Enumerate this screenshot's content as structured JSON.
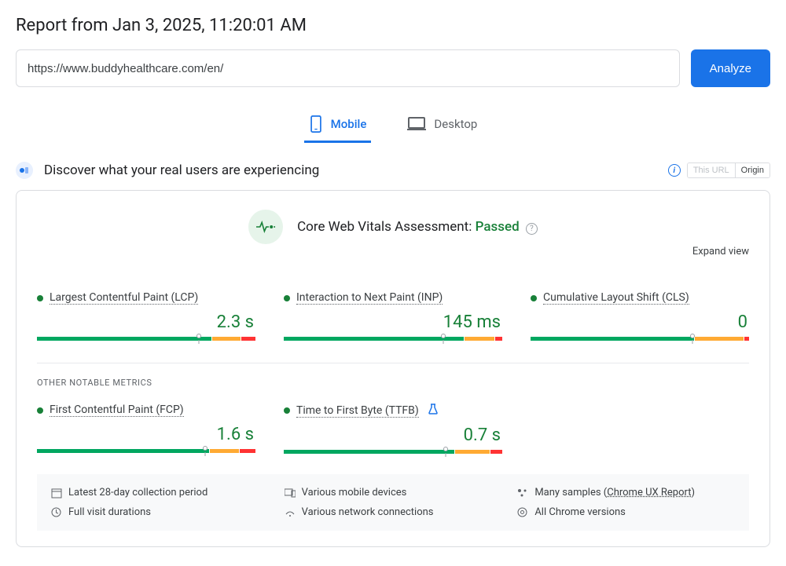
{
  "title": "Report from Jan 3, 2025, 11:20:01 AM",
  "url_value": "https://www.buddyhealthcare.com/en/",
  "analyze_label": "Analyze",
  "tabs": {
    "mobile": "Mobile",
    "desktop": "Desktop"
  },
  "section_head": "Discover what your real users are experiencing",
  "scope_toggle": {
    "this_url": "This URL",
    "origin": "Origin"
  },
  "assessment": {
    "label": "Core Web Vitals Assessment: ",
    "status": "Passed"
  },
  "expand_view": "Expand view",
  "metrics": {
    "lcp": {
      "name": "Largest Contentful Paint (LCP)",
      "value": "2.3 s"
    },
    "inp": {
      "name": "Interaction to Next Paint (INP)",
      "value": "145 ms"
    },
    "cls": {
      "name": "Cumulative Layout Shift (CLS)",
      "value": "0"
    },
    "fcp": {
      "name": "First Contentful Paint (FCP)",
      "value": "1.6 s"
    },
    "ttfb": {
      "name": "Time to First Byte (TTFB)",
      "value": "0.7 s"
    }
  },
  "other_metrics_label": "OTHER NOTABLE METRICS",
  "footer": {
    "period": "Latest 28-day collection period",
    "devices": "Various mobile devices",
    "samples_prefix": "Many samples (",
    "samples_link": "Chrome UX Report",
    "samples_suffix": ")",
    "durations": "Full visit durations",
    "connections": "Various network connections",
    "chrome": "All Chrome versions"
  },
  "chart_data": [
    {
      "metric": "LCP",
      "type": "bar",
      "unit": "s",
      "value": 2.3,
      "segments": {
        "good": 74,
        "needs_improvement": 12,
        "poor": 6
      },
      "marker_pct": 74,
      "thresholds": {
        "good_max": 2.5,
        "poor_min": 4.0
      }
    },
    {
      "metric": "INP",
      "type": "bar",
      "unit": "ms",
      "value": 145,
      "segments": {
        "good": 73,
        "needs_improvement": 12,
        "poor": 3
      },
      "marker_pct": 73,
      "thresholds": {
        "good_max": 200,
        "poor_min": 500
      }
    },
    {
      "metric": "CLS",
      "type": "bar",
      "unit": "",
      "value": 0,
      "segments": {
        "good": 74,
        "needs_improvement": 22,
        "poor": 2
      },
      "marker_pct": 74,
      "thresholds": {
        "good_max": 0.1,
        "poor_min": 0.25
      }
    },
    {
      "metric": "FCP",
      "type": "bar",
      "unit": "s",
      "value": 1.6,
      "segments": {
        "good": 77,
        "needs_improvement": 13,
        "poor": 7
      },
      "marker_pct": 77,
      "thresholds": {
        "good_max": 1.8,
        "poor_min": 3.0
      }
    },
    {
      "metric": "TTFB",
      "type": "bar",
      "unit": "s",
      "value": 0.7,
      "segments": {
        "good": 74,
        "needs_improvement": 15,
        "poor": 5
      },
      "marker_pct": 74,
      "thresholds": {
        "good_max": 0.8,
        "poor_min": 1.8
      }
    }
  ]
}
